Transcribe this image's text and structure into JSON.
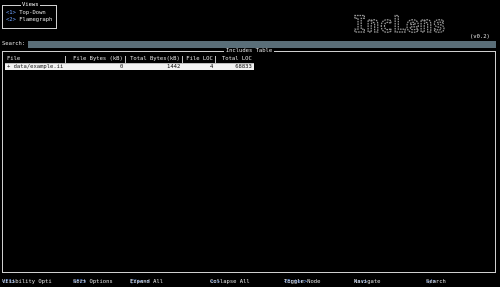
{
  "views": {
    "title": "Views",
    "items": [
      {
        "key": "<1>",
        "label": "Top-Down"
      },
      {
        "key": "<2>",
        "label": "Flamegraph"
      }
    ]
  },
  "logo": {
    "text": "IncLens",
    "version": "(v0.2)"
  },
  "search": {
    "label": "Search:",
    "value": ""
  },
  "table": {
    "title": "Includes Table",
    "columns": [
      "File",
      "File Bytes (kB)",
      "Total Bytes(kB)",
      "File LOC",
      "Total LOC"
    ],
    "rows": [
      {
        "marker": "+",
        "file": "data/example.ii",
        "file_bytes": "0",
        "total_bytes": "1442",
        "file_loc": "4",
        "total_loc": "68833"
      }
    ]
  },
  "footer": [
    {
      "key": "<F1>",
      "label": "Visibility Opti"
    },
    {
      "key": "<F2>",
      "label": "Sort Options"
    },
    {
      "key": "(Y+<->",
      "label": "Expand All"
    },
    {
      "key": "<c>",
      "label": "Collapse All"
    },
    {
      "key": "<Enter>",
      "label": "Toggle Node"
    },
    {
      "key": "<↑↓>",
      "label": "Navigate"
    },
    {
      "key": "</>",
      "label": "Search"
    }
  ],
  "colors": {
    "key_accent": "#6fa3ff",
    "search_bar": "#5a6e78",
    "background": "#000000"
  }
}
